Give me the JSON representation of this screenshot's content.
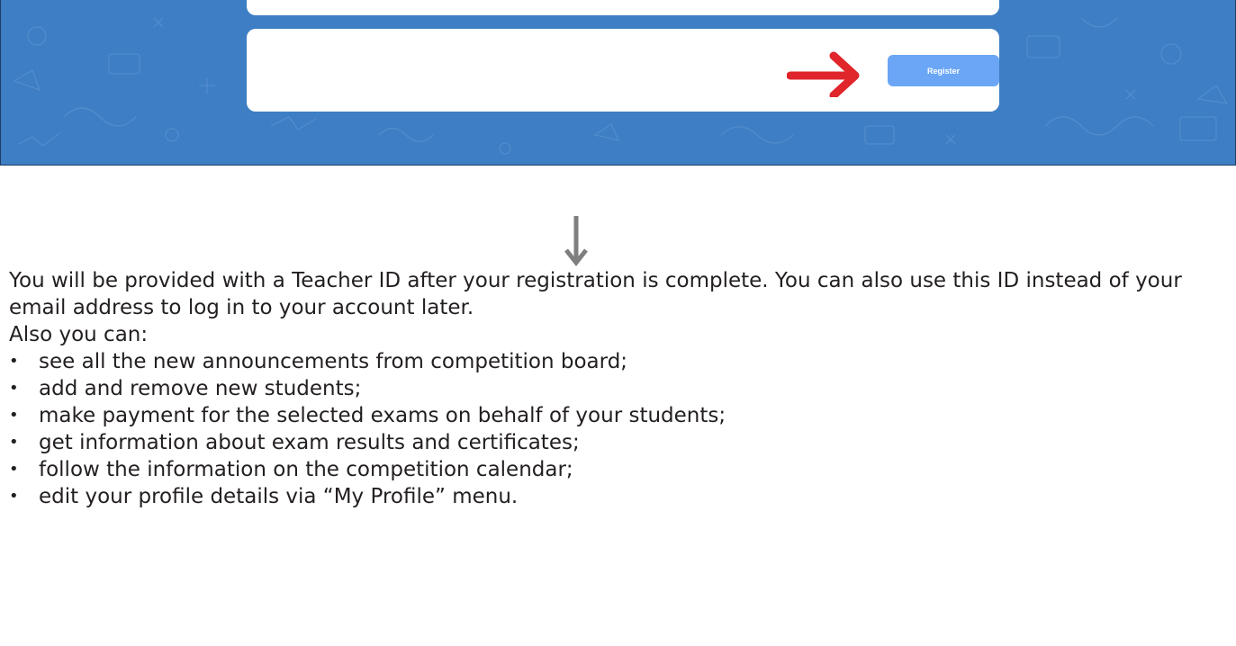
{
  "screenshot": {
    "register_label": "Register",
    "accent_color": "#3d7ec4",
    "button_color": "#6aa6f5",
    "arrow_color": "#e0252b"
  },
  "arrow_icon": "down-arrow-icon",
  "content": {
    "intro": "You will be provided with a Teacher ID after your registration is complete. You can also use this ID instead of your email address to log in to your account later.",
    "also": "Also you can:",
    "bullet_symbol": "•",
    "items": [
      "see all the new announcements from competition board;",
      "add and remove new students;",
      "make payment for the selected exams on behalf of your students;",
      "get information about exam results and certificates;",
      "follow the information on the competition calendar;",
      "edit your profile details via “My Profile” menu."
    ]
  }
}
